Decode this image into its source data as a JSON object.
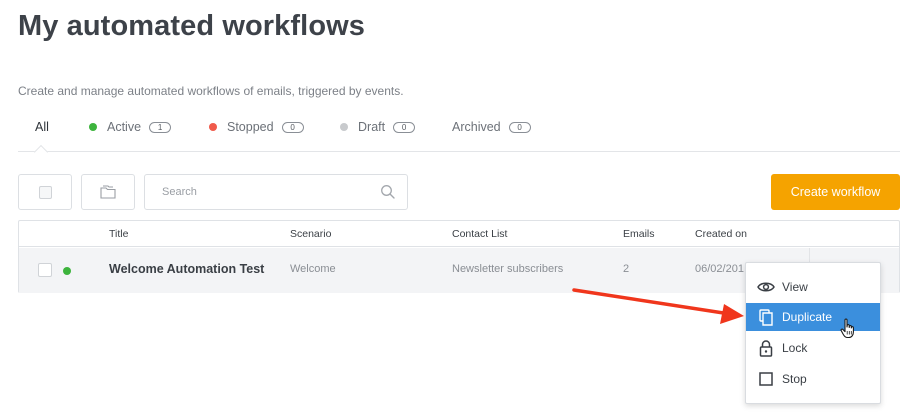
{
  "page": {
    "title": "My automated workflows",
    "subtitle": "Create and manage automated workflows of emails, triggered by events."
  },
  "tabs": [
    {
      "label": "All",
      "count": null,
      "dot_color": null
    },
    {
      "label": "Active",
      "count": "1",
      "dot_color": "#3db43d"
    },
    {
      "label": "Stopped",
      "count": "0",
      "dot_color": "#f05a4b"
    },
    {
      "label": "Draft",
      "count": "0",
      "dot_color": "#c8cacd"
    },
    {
      "label": "Archived",
      "count": "0",
      "dot_color": null
    }
  ],
  "toolbar": {
    "search_placeholder": "Search",
    "create_label": "Create workflow",
    "create_color": "#f5a300"
  },
  "table": {
    "columns": [
      "Title",
      "Scenario",
      "Contact List",
      "Emails",
      "Created on"
    ],
    "rows": [
      {
        "status": "active",
        "status_color": "#3db43d",
        "title": "Welcome Automation Test",
        "scenario": "Welcome",
        "contact_list": "Newsletter subscribers",
        "emails": "2",
        "created_on": "06/02/201"
      }
    ]
  },
  "menu": {
    "items": [
      {
        "label": "View",
        "icon": "eye-icon"
      },
      {
        "label": "Duplicate",
        "icon": "copy-icon",
        "highlighted": true
      },
      {
        "label": "Lock",
        "icon": "lock-icon"
      },
      {
        "label": "Stop",
        "icon": "square-icon"
      }
    ],
    "highlight_color": "#3b8fdd"
  },
  "annotation": {
    "arrow_color": "#f0361c"
  }
}
